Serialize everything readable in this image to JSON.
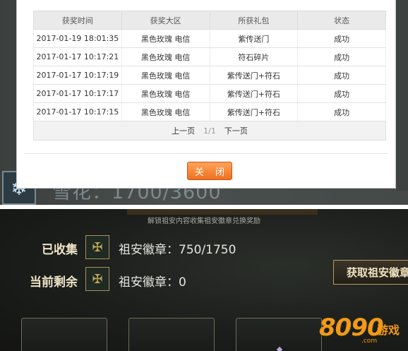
{
  "modal": {
    "table": {
      "headers": [
        "获奖时间",
        "获奖大区",
        "所获礼包",
        "状态"
      ],
      "rows": [
        [
          "2017-01-19 18:01:35",
          "黑色玫瑰 电信",
          "紫传送门",
          "成功"
        ],
        [
          "2017-01-17 10:17:21",
          "黑色玫瑰 电信",
          "符石碎片",
          "成功"
        ],
        [
          "2017-01-17 10:17:19",
          "黑色玫瑰 电信",
          "紫传送门+符石",
          "成功"
        ],
        [
          "2017-01-17 10:17:17",
          "黑色玫瑰 电信",
          "紫传送门+符石",
          "成功"
        ],
        [
          "2017-01-17 10:17:15",
          "黑色玫瑰 电信",
          "紫传送门+符石",
          "成功"
        ]
      ]
    },
    "pager": {
      "prev": "上一页",
      "page": "1/1",
      "next": "下一页"
    },
    "close_label": "关 闭"
  },
  "background_top": {
    "snow_icon": "snowflake-icon",
    "snow_count": "雪花：1700/3600"
  },
  "bottom": {
    "subtitle": "解锁祖安内容收集祖安徽章兑换奖励",
    "collected": {
      "label": "已收集",
      "icon": "zaun-emblem-icon",
      "value": "祖安徽章：750/1750"
    },
    "remaining": {
      "label": "当前剩余",
      "icon": "zaun-emblem-icon",
      "value": "祖安徽章：0"
    },
    "get_button": "获取祖安徽章"
  },
  "watermark": {
    "number": "8090",
    "name": "游戏",
    "domain": ".com"
  },
  "colors": {
    "accent_orange": "#f0701f",
    "gold": "#c6a75c"
  }
}
